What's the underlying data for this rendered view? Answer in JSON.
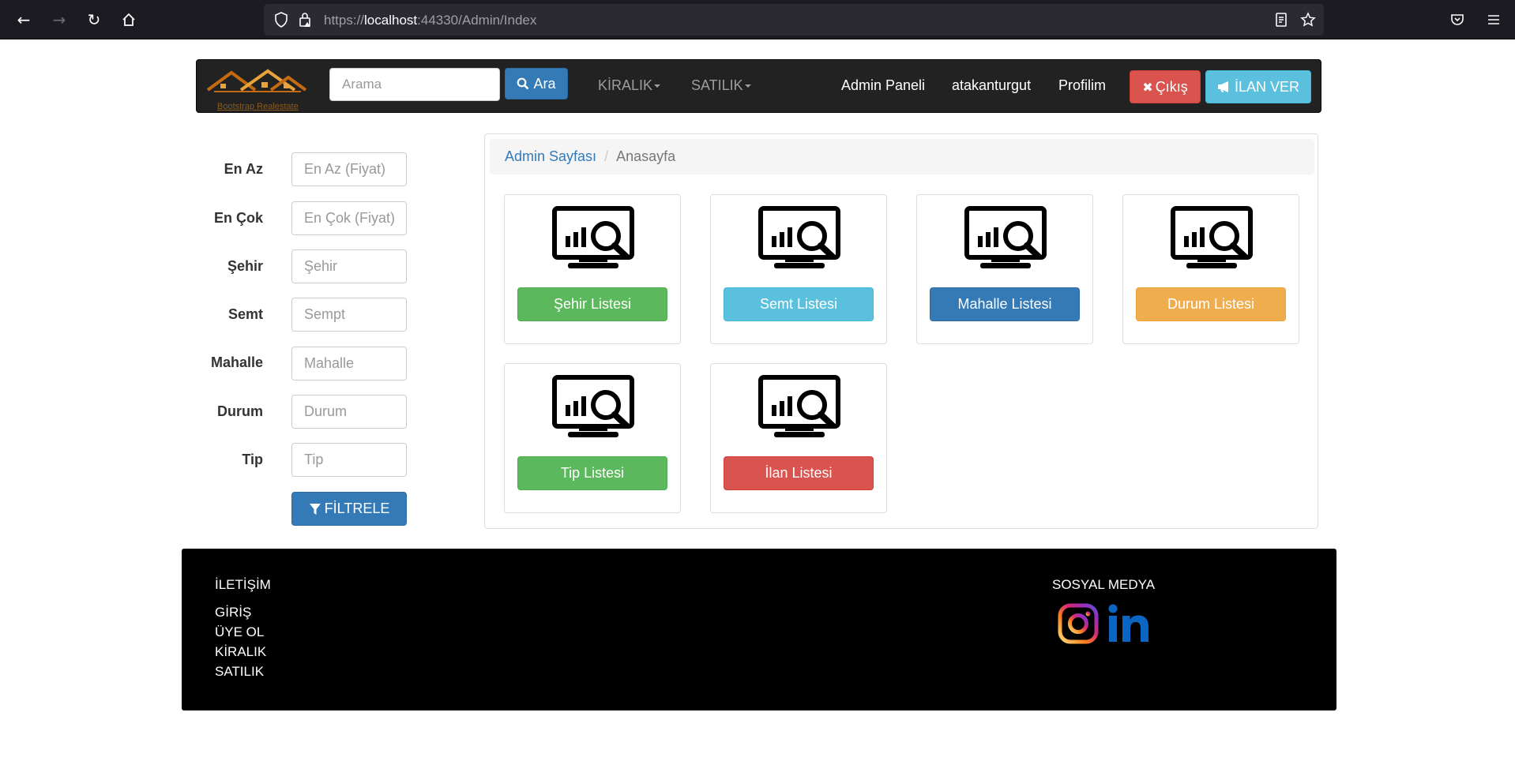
{
  "browser": {
    "url_prefix": "https://",
    "url_host": "localhost",
    "url_rest": ":44330/Admin/Index"
  },
  "navbar": {
    "brand": "Bootstrap Realestate",
    "search_placeholder": "Arama",
    "search_button": "Ara",
    "menu_kiralik": "KİRALIK",
    "menu_satilik": "SATILIK",
    "admin_panel": "Admin Paneli",
    "username": "atakanturgut",
    "profile": "Profilim",
    "exit_button": "Çıkış",
    "ilan_button": "İLAN VER"
  },
  "filters": {
    "fields": [
      {
        "label": "En Az",
        "placeholder": "En Az (Fiyat)"
      },
      {
        "label": "En Çok",
        "placeholder": "En Çok (Fiyat)"
      },
      {
        "label": "Şehir",
        "placeholder": "Şehir"
      },
      {
        "label": "Semt",
        "placeholder": "Sempt"
      },
      {
        "label": "Mahalle",
        "placeholder": "Mahalle"
      },
      {
        "label": "Durum",
        "placeholder": "Durum"
      },
      {
        "label": "Tip",
        "placeholder": "Tip"
      }
    ],
    "button": "FİLTRELE"
  },
  "breadcrumb": {
    "link": "Admin Sayfası",
    "active": "Anasayfa"
  },
  "cards": [
    {
      "label": "Şehir Listesi",
      "style": "success"
    },
    {
      "label": "Semt Listesi",
      "style": "info"
    },
    {
      "label": "Mahalle Listesi",
      "style": "primary"
    },
    {
      "label": "Durum Listesi",
      "style": "warning"
    },
    {
      "label": "Tip Listesi",
      "style": "success"
    },
    {
      "label": "İlan Listesi",
      "style": "danger"
    }
  ],
  "footer": {
    "contact_heading": "İLETİŞİM",
    "links": [
      "GİRİŞ",
      "ÜYE OL",
      "KİRALIK",
      "SATILIK"
    ],
    "social_heading": "SOSYAL MEDYA",
    "social_icons": [
      "instagram-icon",
      "linkedin-icon"
    ]
  }
}
